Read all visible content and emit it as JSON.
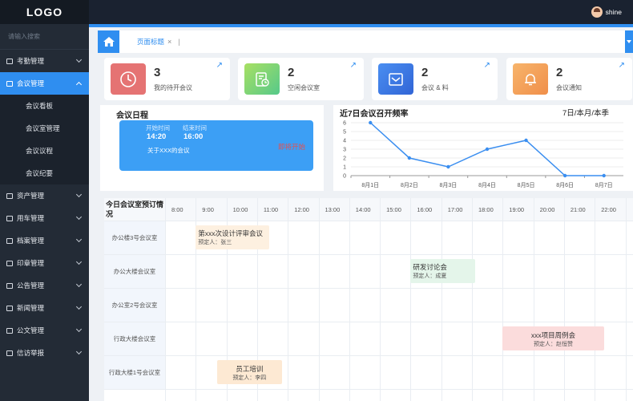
{
  "app": {
    "logo": "LOGO"
  },
  "topbar": {
    "user": "shine"
  },
  "sidebar": {
    "search_placeholder": "请输入搜索",
    "items": [
      {
        "label": "考勤管理"
      },
      {
        "label": "会议管理",
        "children": [
          "会议看板",
          "会议室管理",
          "会议议程",
          "会议纪要"
        ]
      },
      {
        "label": "资产管理"
      },
      {
        "label": "用车管理"
      },
      {
        "label": "档案管理"
      },
      {
        "label": "印章管理"
      },
      {
        "label": "公告管理"
      },
      {
        "label": "新闻管理"
      },
      {
        "label": "公文管理"
      },
      {
        "label": "信访举报"
      }
    ]
  },
  "breadcrumb": {
    "tab": "页面标题",
    "close": "×",
    "sep": "|"
  },
  "stats": [
    {
      "count": "3",
      "label": "我的待开会议",
      "color": "#e57373"
    },
    {
      "count": "2",
      "label": "空闲会议室",
      "color": "#7ed67a"
    },
    {
      "count": "2",
      "label": "会议 & 料",
      "color": "#3f7fe9"
    },
    {
      "count": "2",
      "label": "会议通知",
      "color": "#f4a55a"
    }
  ],
  "schedule": {
    "title": "会议日程",
    "start_label": "开始时间",
    "end_label": "结束时间",
    "start": "14:20",
    "end": "16:00",
    "desc": "关于XXX的会议",
    "status": "即将开始"
  },
  "chart_panel": {
    "title": "近7日会议召开频率",
    "filter": "7日/本月/本季"
  },
  "chart_data": {
    "type": "line",
    "title": "近7日会议召开频率",
    "categories": [
      "8月1日",
      "8月2日",
      "8月3日",
      "8月4日",
      "8月5日",
      "8月6日",
      "8月7日"
    ],
    "values": [
      6,
      2,
      1,
      3,
      4,
      0,
      0
    ],
    "ylim": [
      0,
      6
    ],
    "yticks": [
      0,
      1,
      2,
      3,
      4,
      5,
      6
    ],
    "grid": true,
    "color": "#3a8ef0"
  },
  "booking": {
    "title": "今日会议室预订情况",
    "hours": [
      "8:00",
      "9:00",
      "10:00",
      "11:00",
      "12:00",
      "13:00",
      "14:00",
      "15:00",
      "16:00",
      "17:00",
      "18:00",
      "19:00",
      "20:00",
      "21:00",
      "22:00"
    ],
    "rooms": [
      "办公楼3号会议室",
      "办公大楼会议室",
      "办公室2号会议室",
      "行政大楼会议室",
      "行政大楼1号会议室"
    ],
    "events": [
      {
        "title": "第xxx次设计评审会议",
        "owner": "预定人：张三",
        "room": 0,
        "start": 9.0,
        "end": 11.4,
        "color": "#fdf0e0",
        "align": "left"
      },
      {
        "title": "研发讨论会",
        "owner": "预定人：成夏",
        "room": 1,
        "start": 16.0,
        "end": 18.1,
        "color": "#e4f5ea",
        "align": "left"
      },
      {
        "title": "xxx项目周例会",
        "owner": "预定人：赵恒赞",
        "room": 3,
        "start": 19.0,
        "end": 22.3,
        "color": "#fbdcdc",
        "align": "center"
      },
      {
        "title": "员工培训",
        "owner": "预定人：李四",
        "room": 4,
        "start": 9.7,
        "end": 11.8,
        "color": "#fde9d3",
        "align": "center"
      }
    ]
  }
}
